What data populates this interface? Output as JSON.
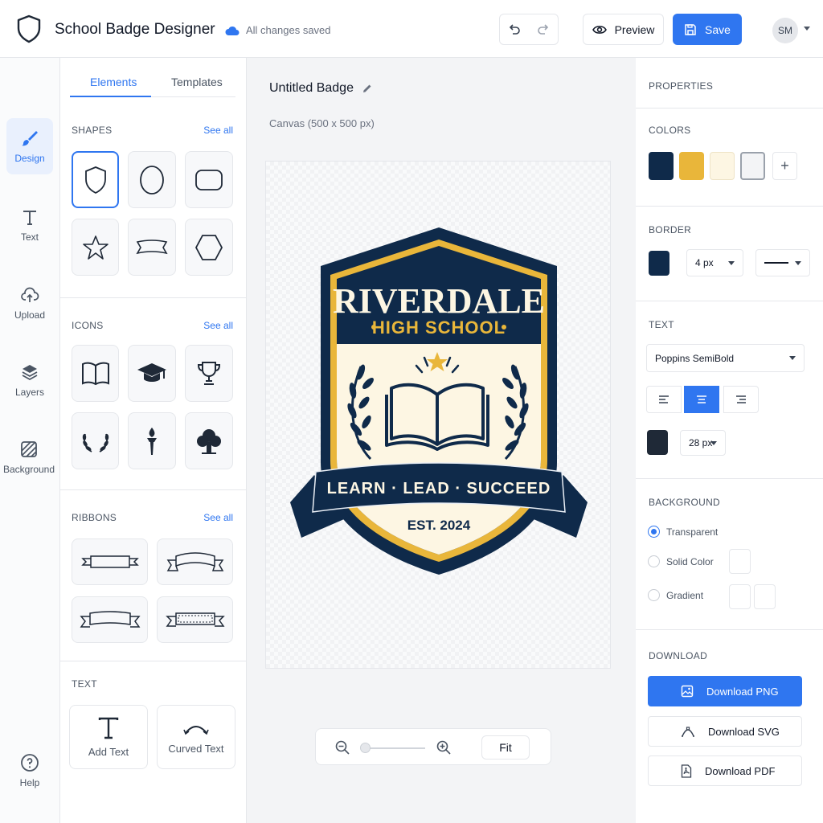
{
  "app": {
    "title": "School Badge Designer",
    "save_status": "All changes saved"
  },
  "toolbar": {
    "preview_label": "Preview",
    "save_label": "Save",
    "avatar_initials": "SM"
  },
  "rail": {
    "items": [
      {
        "label": "Design",
        "icon": "brush-icon",
        "active": true
      },
      {
        "label": "Text",
        "icon": "text-icon"
      },
      {
        "label": "Upload",
        "icon": "upload-icon"
      },
      {
        "label": "Layers",
        "icon": "layers-icon"
      },
      {
        "label": "Background",
        "icon": "background-icon"
      }
    ],
    "help_label": "Help"
  },
  "elements": {
    "tabs": [
      "Elements",
      "Templates"
    ],
    "shapes": {
      "title": "SHAPES",
      "see_all": "See all"
    },
    "icons": {
      "title": "ICONS",
      "see_all": "See all"
    },
    "ribbons": {
      "title": "RIBBONS",
      "see_all": "See all"
    },
    "text": {
      "title": "TEXT",
      "add_text": "Add Text",
      "curved_text": "Curved Text"
    }
  },
  "canvas": {
    "badge_name": "Untitled Badge",
    "size_label": "Canvas (500 x 500 px)",
    "fit_label": "Fit",
    "badge": {
      "school": "RIVERDALE",
      "subtitle": "HIGH SCHOOL",
      "motto": "LEARN · LEAD · SUCCEED",
      "est": "EST. 2024"
    }
  },
  "properties": {
    "title": "PROPERTIES",
    "colors": {
      "title": "COLORS",
      "swatches": [
        "#0f2a4a",
        "#e9b63a",
        "#fdf6e3",
        "#f3f4f6"
      ],
      "add": "+"
    },
    "border": {
      "title": "BORDER",
      "color": "#0f2a4a",
      "width": "4 px"
    },
    "text": {
      "title": "TEXT",
      "font": "Poppins SemiBold",
      "color": "#1f2937",
      "size": "28 px"
    },
    "background": {
      "title": "BACKGROUND",
      "options": [
        "Transparent",
        "Solid Color",
        "Gradient"
      ],
      "selected": "Transparent"
    },
    "download": {
      "title": "DOWNLOAD",
      "png": "Download PNG",
      "svg": "Download SVG",
      "pdf": "Download PDF"
    }
  },
  "colors": {
    "accent": "#2f76f0",
    "navy": "#0f2a4a",
    "gold": "#e9b63a",
    "cream": "#fdf6e3"
  }
}
